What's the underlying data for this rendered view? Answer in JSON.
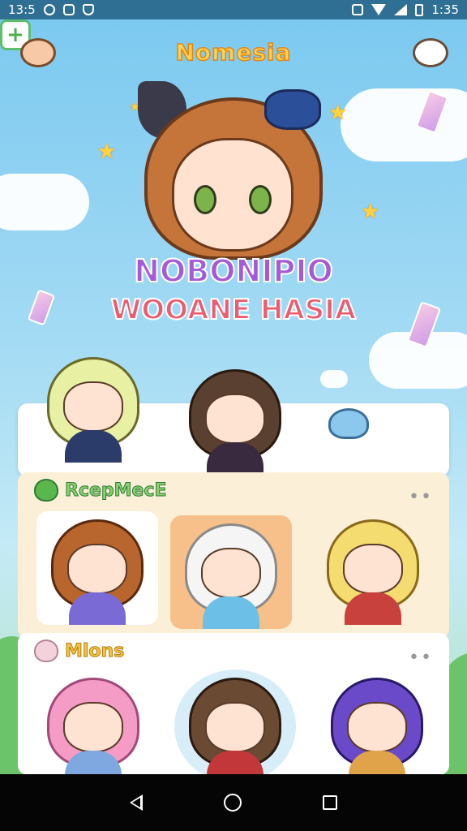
{
  "status_bar": {
    "time_left": "13:5",
    "time_right": "1:35",
    "icons": [
      "circle-icon",
      "signal-icon",
      "shield-icon",
      "mute-icon",
      "wifi-icon",
      "battery-icon"
    ]
  },
  "header": {
    "title": "Nomesia",
    "menu_icon": "mushroom-icon",
    "add_icon": "add-icon",
    "profile_icon": "mascot-icon",
    "add_label": "+"
  },
  "hero": {
    "line1": "NOBONIPIO",
    "line2": "WOOANE HASIA"
  },
  "sections": [
    {
      "title": "RcepMecE",
      "icon": "green-heart-icon",
      "more": "••",
      "items": [
        "Brown-haired chibi with blue bow",
        "White-haired chibi with flowers",
        "Blonde cat-eared chibi with bread"
      ]
    },
    {
      "title": "Mlons",
      "icon": "pink-heart-icon",
      "more": "••",
      "items": [
        "Pink-haired chibi",
        "Brown-haired chibi with cup",
        "Purple-haired chibi"
      ]
    }
  ],
  "nav": {
    "back": "back-icon",
    "home": "home-icon",
    "recent": "recent-apps-icon"
  },
  "colors": {
    "sky": "#7ec8ee",
    "title": "#ffd24a",
    "accent_green": "#5cbf6e",
    "section_bg": "#fbefd7"
  }
}
